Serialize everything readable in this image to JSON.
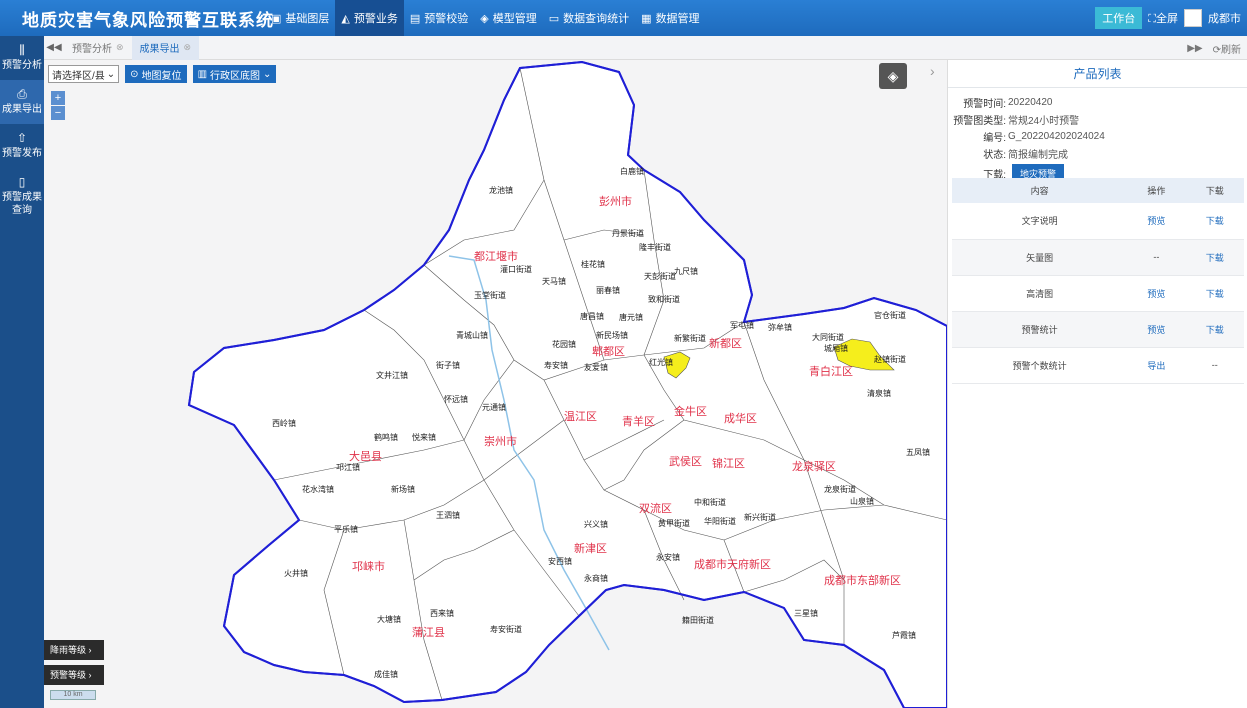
{
  "header": {
    "title": "地质灾害气象风险预警互联系统",
    "nav": [
      {
        "label": "基础图层",
        "icon": "monitor-icon"
      },
      {
        "label": "预警业务",
        "icon": "chart-icon",
        "active": true
      },
      {
        "label": "预警校验",
        "icon": "document-icon"
      },
      {
        "label": "模型管理",
        "icon": "model-icon"
      },
      {
        "label": "数据查询统计",
        "icon": "chat-icon"
      },
      {
        "label": "数据管理",
        "icon": "database-icon"
      }
    ],
    "workbench_label": "工作台",
    "fullscreen_label": "全屏",
    "city_label": "成都市"
  },
  "sidebar": {
    "items": [
      {
        "label": "预警分析",
        "icon": "analysis-icon"
      },
      {
        "label": "成果导出",
        "icon": "export-icon",
        "active": true
      },
      {
        "label": "预警发布",
        "icon": "publish-icon"
      },
      {
        "label": "预警成果查询",
        "icon": "query-icon"
      }
    ]
  },
  "tabs": [
    {
      "label": "预警分析"
    },
    {
      "label": "成果导出",
      "active": true
    }
  ],
  "tab_refresh_label": "刷新",
  "map": {
    "district_select": "请选择区/县",
    "reset_label": "地图复位",
    "basemap_label": "行政区底图",
    "zoom_in": "+",
    "zoom_out": "−",
    "rain_level_label": "降雨等级",
    "warning_level_label": "预警等级",
    "scale_label": "10 km",
    "boundary_color": "#1f1fd6",
    "warning_area_color": "#f5ee1c",
    "district_labels": [
      "都江堰市",
      "彭州市",
      "新都区",
      "郫都区",
      "青白江区",
      "温江区",
      "金牛区",
      "成华区",
      "青羊区",
      "崇州市",
      "大邑县",
      "武侯区",
      "锦江区",
      "龙泉驿区",
      "双流区",
      "新津区",
      "邛崃市",
      "成都市天府新区",
      "成都市东部新区",
      "蒲江县"
    ],
    "town_labels": [
      "龙池镇",
      "白鹿镇",
      "丹景街道",
      "隆丰街道",
      "九尺镇",
      "天彭街道",
      "致和街道",
      "丽春镇",
      "桂花镇",
      "天马镇",
      "灌口街道",
      "玉堂街道",
      "青城山镇",
      "唐昌镇",
      "花园镇",
      "新民场镇",
      "唐元镇",
      "新繁街道",
      "军屯镇",
      "弥牟镇",
      "大同街道",
      "城厢镇",
      "赵镇街道",
      "官仓街道",
      "红光镇",
      "友爱镇",
      "寿安镇",
      "文井江镇",
      "街子镇",
      "怀远镇",
      "元通镇",
      "西岭镇",
      "鹤鸣镇",
      "悦来镇",
      "邛江镇",
      "花水湾镇",
      "新场镇",
      "王泗镇",
      "平乐镇",
      "火井镇",
      "大塘镇",
      "西来镇",
      "寿安街道",
      "成佳镇",
      "永安镇",
      "籍田街道",
      "三星镇",
      "芦霞镇",
      "山泉镇",
      "龙泉街道",
      "清泉镇",
      "五凤镇",
      "黄甲街道",
      "华阳街道",
      "中和街道",
      "新兴街道",
      "安西镇",
      "兴义镇",
      "永商镇"
    ]
  },
  "panel": {
    "title": "产品列表",
    "time_label": "预警时间:",
    "time_value": "20220420",
    "type_label": "预警图类型:",
    "type_value": "常规24小时预警",
    "id_label": "编号:",
    "id_value": "G_202204202024024",
    "status_label": "状态:",
    "status_value": "简报编制完成",
    "download_label": "下载:",
    "download_button": "地灾预警",
    "table": {
      "headers": [
        "内容",
        "操作",
        "下载"
      ],
      "rows": [
        [
          "文字说明",
          "预览",
          "下载"
        ],
        [
          "矢量图",
          "--",
          "下载"
        ],
        [
          "高清图",
          "预览",
          "下载"
        ],
        [
          "预警统计",
          "预览",
          "下载"
        ],
        [
          "预警个数统计",
          "导出",
          "--"
        ]
      ]
    }
  }
}
